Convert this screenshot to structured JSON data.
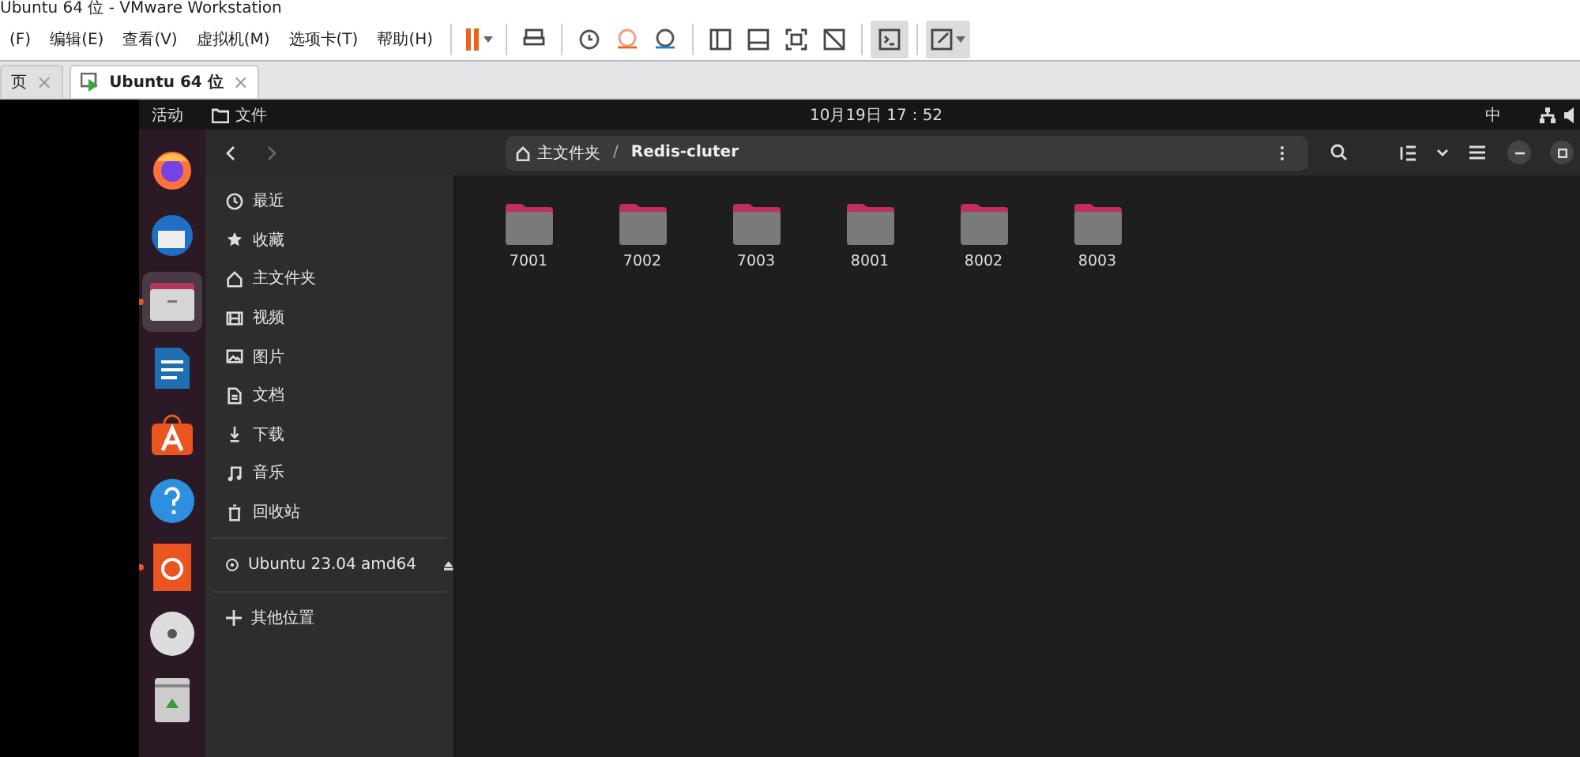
{
  "window": {
    "title": "Ubuntu 64 位 - VMware Workstation"
  },
  "menu": [
    "(F)",
    "编辑(E)",
    "查看(V)",
    "虚拟机(M)",
    "选项卡(T)",
    "帮助(H)"
  ],
  "tabs": [
    {
      "label": "页",
      "close": "×",
      "selected": false
    },
    {
      "label": "Ubuntu 64 位",
      "close": "×",
      "selected": true
    }
  ],
  "topbar": {
    "activities": "活动",
    "app": "文件",
    "clock": "10月19日 17：52",
    "input_method": "中"
  },
  "dock": [
    {
      "kind": "browser",
      "running": false,
      "selected": false
    },
    {
      "kind": "mail",
      "running": false,
      "selected": false
    },
    {
      "kind": "files",
      "running": true,
      "selected": true
    },
    {
      "kind": "writer",
      "running": false,
      "selected": false
    },
    {
      "kind": "store",
      "running": false,
      "selected": false
    },
    {
      "kind": "help",
      "running": false,
      "selected": false
    },
    {
      "kind": "installer",
      "running": true,
      "selected": false
    },
    {
      "kind": "disc",
      "running": false,
      "selected": false
    },
    {
      "kind": "trash",
      "running": false,
      "selected": false
    }
  ],
  "header": {
    "back_enabled": true,
    "forward_enabled": false,
    "path": [
      {
        "kind": "home",
        "label": "主文件夹"
      },
      {
        "kind": "sep",
        "label": "/"
      },
      {
        "kind": "current",
        "label": "Redis-cluter"
      }
    ]
  },
  "sidebar": {
    "places": [
      {
        "kind": "recent",
        "label": "最近"
      },
      {
        "kind": "star",
        "label": "收藏"
      },
      {
        "kind": "home",
        "label": "主文件夹"
      },
      {
        "kind": "video",
        "label": "视频"
      },
      {
        "kind": "picture",
        "label": "图片"
      },
      {
        "kind": "document",
        "label": "文档"
      },
      {
        "kind": "download",
        "label": "下载"
      },
      {
        "kind": "music",
        "label": "音乐"
      },
      {
        "kind": "trash",
        "label": "回收站"
      }
    ],
    "devices": [
      {
        "label": "Ubuntu 23.04 amd64"
      }
    ],
    "other": "其他位置"
  },
  "folders": [
    "7001",
    "7002",
    "7003",
    "8001",
    "8002",
    "8003"
  ]
}
